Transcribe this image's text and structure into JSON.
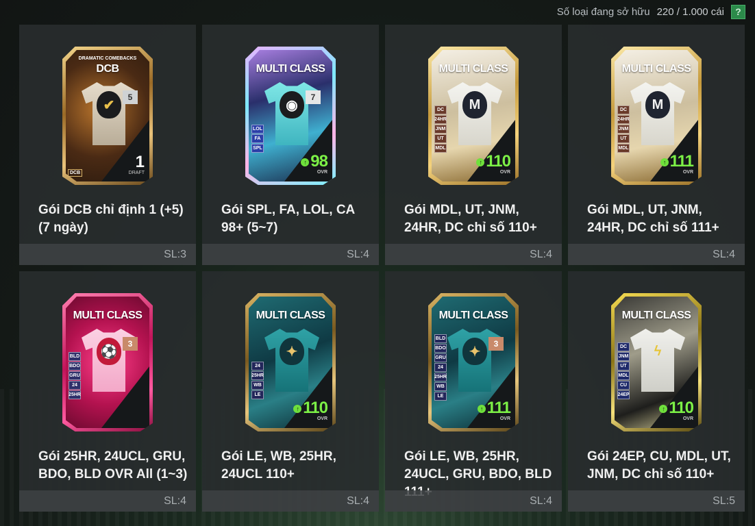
{
  "header": {
    "owned_label": "Số loại đang sở hữu",
    "owned_count": "220 / 1.000 cái",
    "help_label": "?"
  },
  "colors": {
    "ovr_green": "#7cf046",
    "help_button": "#2c8a4a"
  },
  "packs": [
    {
      "name": "Gói DCB chỉ định 1 (+5) (7 ngày)",
      "quantity": "SL:3",
      "card": {
        "title": "DCB",
        "subtitle": "DRAMATIC COMEBACKS",
        "badge": "5",
        "stat": "1",
        "stat_label": "DRAFT",
        "tags": [
          "DCB"
        ],
        "theme": "gold-bronze",
        "icon": "checkmark-shield-icon"
      }
    },
    {
      "name": "Gói SPL, FA, LOL, CA 98+ (5~7)",
      "quantity": "SL:4",
      "card": {
        "title": "MULTI CLASS",
        "badge": "7",
        "stat": "98",
        "stat_label": "OVR",
        "tags": [
          "LOL",
          "FA",
          "SPL"
        ],
        "theme": "holo-cyan",
        "icon": "spotlight-eye-icon",
        "crest_label": "SPOTLIGHT"
      }
    },
    {
      "name": "Gói MDL, UT, JNM, 24HR, DC chỉ số 110+",
      "quantity": "SL:4",
      "card": {
        "title": "MULTI CLASS",
        "stat": "110",
        "stat_label": "OVR",
        "tags": [
          "DC",
          "24HR",
          "JNM",
          "UT",
          "MDL"
        ],
        "theme": "gold-white",
        "icon": "medalist-crest-icon"
      }
    },
    {
      "name": "Gói MDL, UT, JNM, 24HR, DC chỉ số 111+",
      "quantity": "SL:4",
      "card": {
        "title": "MULTI CLASS",
        "stat": "111",
        "stat_label": "OVR",
        "tags": [
          "DC",
          "24HR",
          "JNM",
          "UT",
          "MDL"
        ],
        "theme": "gold-white",
        "icon": "medalist-crest-icon"
      }
    },
    {
      "name": "Gói 25HR, 24UCL, GRU, BDO, BLD OVR All (1~3)",
      "quantity": "SL:4",
      "card": {
        "title": "MULTI CLASS",
        "badge": "3",
        "tags": [
          "BLD",
          "BDO",
          "GRU",
          "24",
          "25HR"
        ],
        "theme": "pink",
        "icon": "football-crest-icon"
      }
    },
    {
      "name": "Gói LE, WB, 25HR, 24UCL 110+",
      "quantity": "SL:4",
      "card": {
        "title": "MULTI CLASS",
        "stat": "110",
        "stat_label": "OVR",
        "tags": [
          "24",
          "25HR",
          "WB",
          "LE"
        ],
        "theme": "teal",
        "icon": "star-crest-icon"
      }
    },
    {
      "name": "Gói LE, WB, 25HR, 24UCL, GRU, BDO, BLD 111+",
      "quantity": "SL:4",
      "card": {
        "title": "MULTI CLASS",
        "badge": "3",
        "stat": "111",
        "stat_label": "OVR",
        "tags": [
          "BLD",
          "BDO",
          "GRU",
          "24",
          "25HR",
          "WB",
          "LE"
        ],
        "theme": "teal",
        "icon": "star-crest-icon"
      }
    },
    {
      "name": "Gói 24EP, CU, MDL, UT, JNM, DC chỉ số 110+",
      "quantity": "SL:5",
      "card": {
        "title": "MULTI CLASS",
        "stat": "110",
        "stat_label": "OVR",
        "tags": [
          "DC",
          "JNM",
          "UT",
          "MDL",
          "CU",
          "24EP"
        ],
        "theme": "black-gold",
        "icon": "ep-lightning-icon"
      }
    }
  ]
}
